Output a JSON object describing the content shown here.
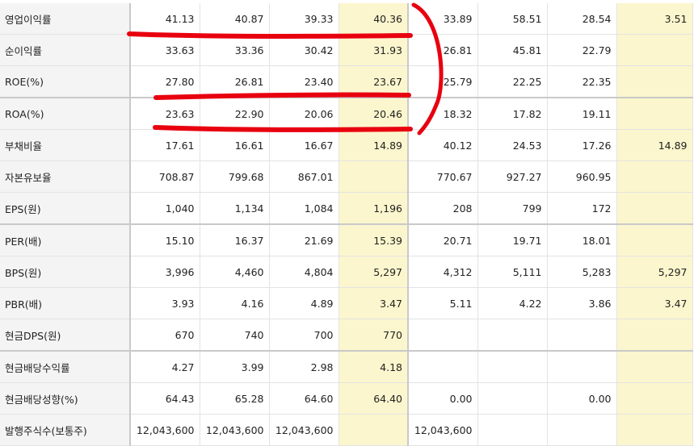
{
  "rows": [
    {
      "label": "영업이익률",
      "values": [
        "41.13",
        "40.87",
        "39.33",
        "40.36",
        "33.89",
        "58.51",
        "28.54",
        "3.51"
      ]
    },
    {
      "label": "순이익률",
      "values": [
        "33.63",
        "33.36",
        "30.42",
        "31.93",
        "26.81",
        "45.81",
        "22.79",
        ""
      ]
    },
    {
      "label": "ROE(%)",
      "values": [
        "27.80",
        "26.81",
        "23.40",
        "23.67",
        "25.79",
        "22.25",
        "22.35",
        ""
      ]
    },
    {
      "label": "ROA(%)",
      "values": [
        "23.63",
        "22.90",
        "20.06",
        "20.46",
        "18.32",
        "17.82",
        "19.11",
        ""
      ]
    },
    {
      "label": "부채비율",
      "values": [
        "17.61",
        "16.61",
        "16.67",
        "14.89",
        "40.12",
        "24.53",
        "17.26",
        "14.89"
      ]
    },
    {
      "label": "자본유보율",
      "values": [
        "708.87",
        "799.68",
        "867.01",
        "",
        "770.67",
        "927.27",
        "960.95",
        ""
      ]
    },
    {
      "label": "EPS(원)",
      "values": [
        "1,040",
        "1,134",
        "1,084",
        "1,196",
        "208",
        "799",
        "172",
        ""
      ]
    },
    {
      "label": "PER(배)",
      "values": [
        "15.10",
        "16.37",
        "21.69",
        "15.39",
        "20.71",
        "19.71",
        "18.01",
        ""
      ]
    },
    {
      "label": "BPS(원)",
      "values": [
        "3,996",
        "4,460",
        "4,804",
        "5,297",
        "4,312",
        "5,111",
        "5,283",
        "5,297"
      ]
    },
    {
      "label": "PBR(배)",
      "values": [
        "3.93",
        "4.16",
        "4.89",
        "3.47",
        "5.11",
        "4.22",
        "3.86",
        "3.47"
      ]
    },
    {
      "label": "현금DPS(원)",
      "values": [
        "670",
        "740",
        "700",
        "770",
        "",
        "",
        "",
        ""
      ]
    },
    {
      "label": "현금배당수익률",
      "values": [
        "4.27",
        "3.99",
        "2.98",
        "4.18",
        "",
        "",
        "",
        ""
      ]
    },
    {
      "label": "현금배당성향(%)",
      "values": [
        "64.43",
        "65.28",
        "64.60",
        "64.40",
        "0.00",
        "",
        "0.00",
        ""
      ]
    },
    {
      "label": "발행주식수(보통주)",
      "values": [
        "12,043,600",
        "12,043,600",
        "12,043,600",
        "",
        "12,043,600",
        "",
        "",
        ""
      ]
    }
  ],
  "colors": {
    "highlight": "#fbf6cd",
    "label_bg": "#f4f4f4",
    "annotation": "#e8000f"
  }
}
